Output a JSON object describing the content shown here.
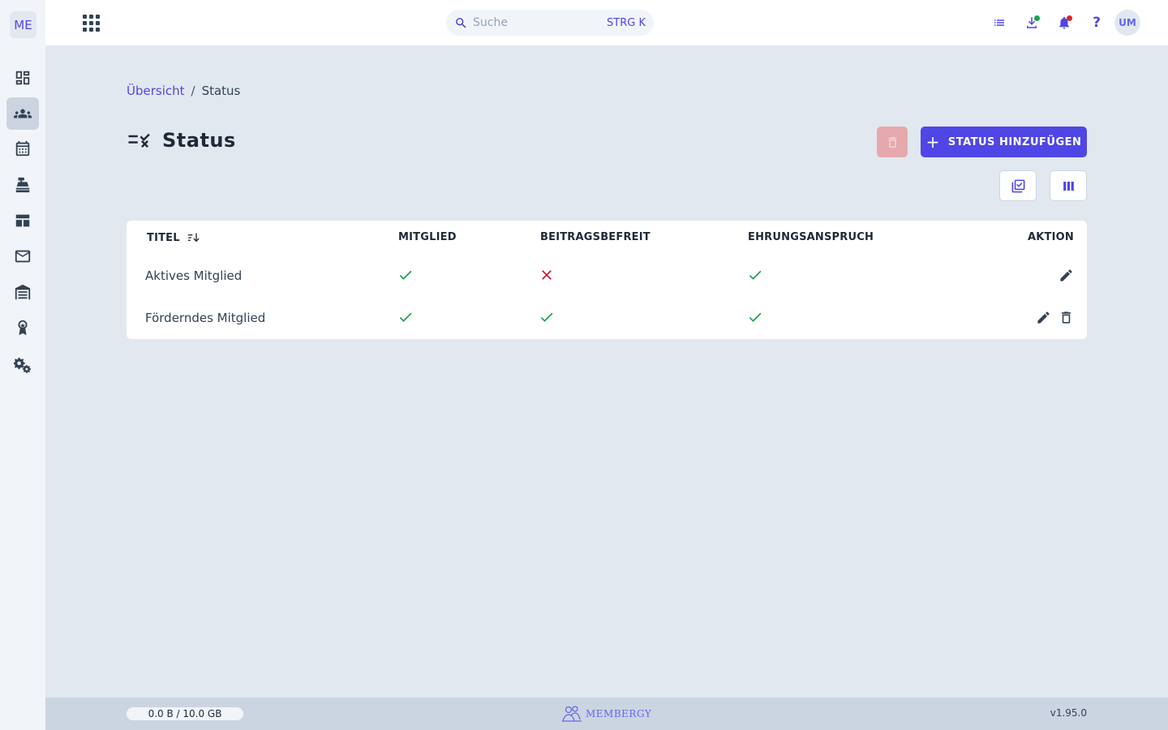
{
  "sidebar": {
    "logo": "ME",
    "items": [
      {
        "name": "dashboard",
        "active": false
      },
      {
        "name": "members",
        "active": true
      },
      {
        "name": "calendar",
        "active": false
      },
      {
        "name": "cash-register",
        "active": false
      },
      {
        "name": "layout",
        "active": false
      },
      {
        "name": "mail",
        "active": false
      },
      {
        "name": "warehouse",
        "active": false
      },
      {
        "name": "award",
        "active": false
      },
      {
        "name": "settings",
        "active": false
      }
    ]
  },
  "topbar": {
    "search_placeholder": "Suche",
    "search_shortcut": "STRG K",
    "help_label": "?",
    "avatar_initials": "UM",
    "download_badge_color": "#16a34a",
    "notification_badge_color": "#dc2626"
  },
  "breadcrumb": {
    "home": "Übersicht",
    "separator": "/",
    "current": "Status"
  },
  "page": {
    "title": "Status",
    "add_button_label": "STATUS HINZUFÜGEN",
    "accent_color": "#4f46e5"
  },
  "table": {
    "columns": [
      "TITEL",
      "MITGLIED",
      "BEITRAGSBEFREIT",
      "EHRUNGSANSPRUCH",
      "AKTION"
    ],
    "rows": [
      {
        "title": "Aktives Mitglied",
        "mitglied": true,
        "beitragsbefreit": false,
        "ehrungsanspruch": true,
        "actions": [
          "edit"
        ]
      },
      {
        "title": "Förderndes Mitglied",
        "mitglied": true,
        "beitragsbefreit": true,
        "ehrungsanspruch": true,
        "actions": [
          "edit",
          "delete"
        ]
      }
    ]
  },
  "footer": {
    "storage": "0.0 B / 10.0 GB",
    "brand": "MEMBERGY",
    "version": "v1.95.0"
  }
}
